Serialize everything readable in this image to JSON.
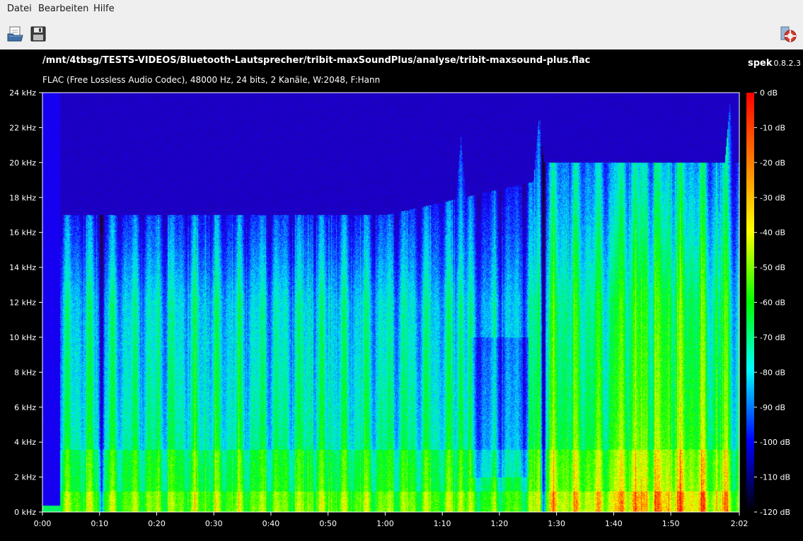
{
  "menu": {
    "items": [
      {
        "label": "Datei"
      },
      {
        "label": "Bearbeiten"
      },
      {
        "label": "Hilfe"
      }
    ]
  },
  "toolbar": {
    "buttons": [
      {
        "icon": "open-file-icon"
      },
      {
        "icon": "save-icon"
      },
      {
        "icon": "help-lifebuoy-icon"
      }
    ]
  },
  "header": {
    "file_path": "/mnt/4tbsg/TESTS-VIDEOS/Bluetooth-Lautsprecher/tribit-maxSoundPlus/analyse/tribit-maxsound-plus.flac",
    "app_name": "spek",
    "app_version": "0.8.2.3",
    "file_info": "FLAC (Free Lossless Audio Codec), 48000 Hz, 24 bits, 2 Kanäle, W:2048, F:Hann"
  },
  "chart_data": {
    "type": "heatmap",
    "title": "",
    "xlabel": "",
    "ylabel": "",
    "x_ticks": [
      "0:00",
      "0:10",
      "0:20",
      "0:30",
      "0:40",
      "0:50",
      "1:00",
      "1:10",
      "1:20",
      "1:30",
      "1:40",
      "1:50",
      "2:02"
    ],
    "x_tick_seconds": [
      0,
      10,
      20,
      30,
      40,
      50,
      60,
      70,
      80,
      90,
      100,
      110,
      122
    ],
    "xlim_seconds": [
      0,
      122
    ],
    "y_ticks": [
      "0 kHz",
      "2 kHz",
      "4 kHz",
      "6 kHz",
      "8 kHz",
      "10 kHz",
      "12 kHz",
      "14 kHz",
      "16 kHz",
      "18 kHz",
      "20 kHz",
      "22 kHz",
      "24 kHz"
    ],
    "y_tick_khz": [
      0,
      2,
      4,
      6,
      8,
      10,
      12,
      14,
      16,
      18,
      20,
      22,
      24
    ],
    "ylim_khz": [
      0,
      24
    ],
    "colorbar": {
      "labels": [
        "0 dB",
        "-10 dB",
        "-20 dB",
        "-30 dB",
        "-40 dB",
        "-50 dB",
        "-60 dB",
        "-70 dB",
        "-80 dB",
        "-90 dB",
        "-100 dB",
        "-110 dB",
        "-120 dB"
      ],
      "values_db": [
        0,
        -10,
        -20,
        -30,
        -40,
        -50,
        -60,
        -70,
        -80,
        -90,
        -100,
        -110,
        -120
      ],
      "range_db": [
        -120,
        0
      ],
      "colors": [
        "#ff0000",
        "#ff8000",
        "#ffff00",
        "#00ff00",
        "#00ffff",
        "#0000ff",
        "#000000"
      ]
    },
    "features": {
      "silent_start_seconds": 3,
      "lowpass_cutoff_khz_first_section": 17,
      "lowpass_cutoff_khz_last_section": 20,
      "gap_seconds": [
        10.3,
        87.6
      ],
      "bright_transient_seconds": [
        73.2,
        86.8,
        120.3
      ]
    }
  }
}
